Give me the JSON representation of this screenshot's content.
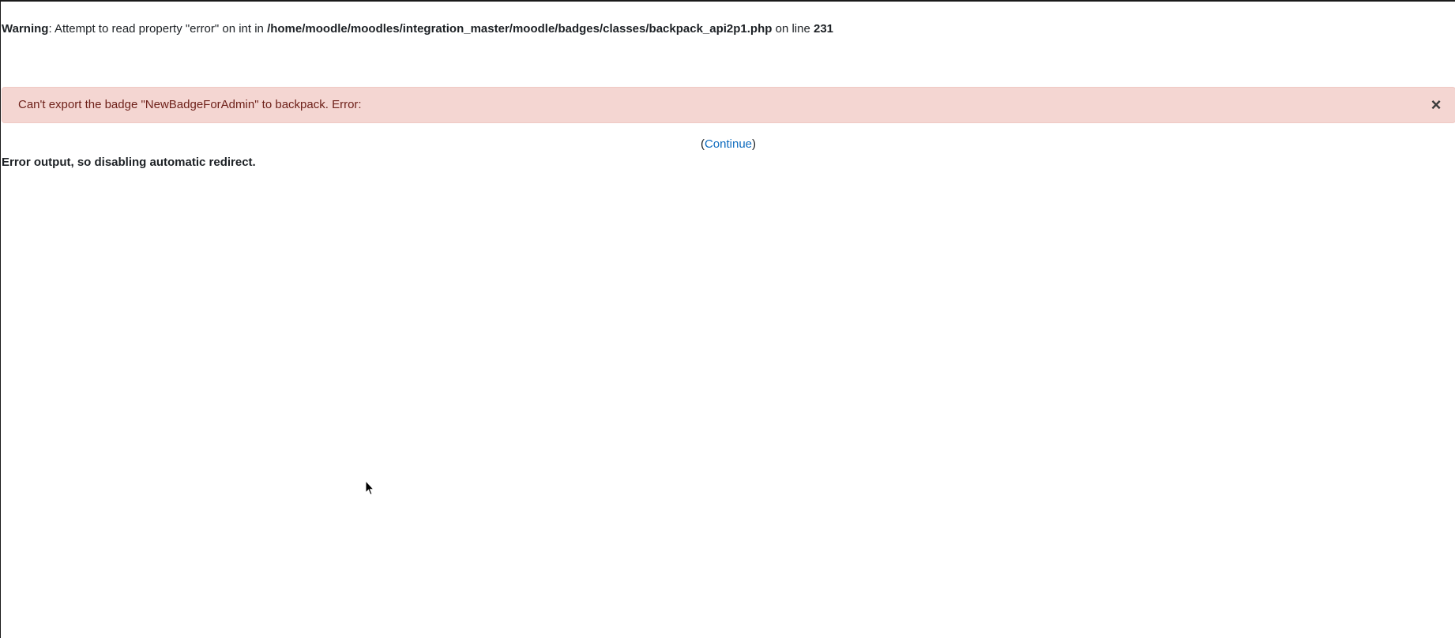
{
  "warning": {
    "label": "Warning",
    "text_before_path": ": Attempt to read property \"error\" on int in ",
    "path": "/home/moodle/moodles/integration_master/moodle/badges/classes/backpack_api2p1.php",
    "text_before_line": " on line ",
    "line": "231"
  },
  "alert": {
    "message": "Can't export the badge \"NewBadgeForAdmin\" to backpack. Error:",
    "close_glyph": "×",
    "background": "#f4d6d2",
    "text_color": "#6e211a"
  },
  "continue": {
    "open_paren": "(",
    "link_label": "Continue",
    "close_paren": ")",
    "link_color": "#0f6cbf"
  },
  "redirect_notice": "Error output, so disabling automatic redirect."
}
